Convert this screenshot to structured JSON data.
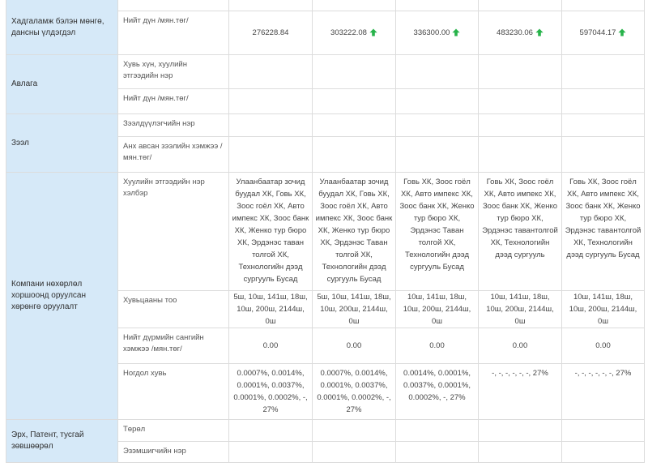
{
  "sections": {
    "assets": {
      "title": "Хадгаламж бэлэн мөнгө, дансны үлдэгдэл",
      "net_label": "Нийт дүн /мян.төг/",
      "values": [
        "276228.84",
        "303222.08",
        "336300.00",
        "483230.06",
        "597044.17"
      ],
      "trend": [
        "none",
        "up",
        "up",
        "up",
        "up"
      ]
    },
    "receivables": {
      "title": "Авлага",
      "person_label": "Хувь хүн, хуулийн этгээдийн нэр",
      "net_label": "Нийт дүн /мян.төг/"
    },
    "loans": {
      "title": "Зээл",
      "lender_label": "Зээлдүүлэгчийн нэр",
      "amount_label": "Анх авсан зээлийн хэмжээ /мян.төг/"
    },
    "investments": {
      "title": "Компани нөхөрлөл хоршоонд оруулсан хөрөнгө оруулалт",
      "entity_label": "Хуулийн этгээдийн нэр хэлбэр",
      "entity_values": [
        "Улаанбаатар зочид буудал ХК, Говь ХК, Зоос гоёл ХК, Авто импекс ХК, Зоос банк ХК, Женко тур бюро ХК, Эрдэнэс таван толгой ХК, Технологийн дээд сургууль Бусад",
        "Улаанбаатар зочид буудал ХК, Говь ХК, Зоос гоёл ХК, Авто импекс ХК, Зоос банк ХК, Женко тур бюро ХК, Эрдэнэс Таван толгой ХК, Технологийн дээд сургууль Бусад",
        "Говь ХК, Зоос гоёл ХК, Авто импекс ХК, Зоос банк ХК, Женко тур бюро ХК, Эрдэнэс Таван толгой ХК, Технологийн дээд сургууль Бусад",
        "Говь ХК, Зоос гоёл ХК, Авто импекс ХК, Зоос банк ХК, Женко тур бюро ХК, Эрдэнэс тавантолгой ХК, Технологийн дээд сургууль",
        "Говь ХК, Зоос гоёл ХК, Авто импекс ХК, Зоос банк ХК, Женко тур бюро ХК, Эрдэнэс тавантолгой ХК, Технологийн дээд сургууль Бусад"
      ],
      "shares_label": "Хувьцааны тоо",
      "shares_values": [
        "5ш, 10ш, 141ш, 18ш, 10ш, 200ш, 2144ш, 0ш",
        "5ш, 10ш, 141ш, 18ш, 10ш, 200ш, 2144ш, 0ш",
        "10ш, 141ш, 18ш, 10ш, 200ш, 2144ш, 0ш",
        "10ш, 141ш, 18ш, 10ш, 200ш, 2144ш, 0ш",
        "10ш, 141ш, 18ш, 10ш, 200ш, 2144ш, 0ш"
      ],
      "capital_label": "Нийт дүрмийн сангийн хэмжээ /мян.төг/",
      "capital_values": [
        "0.00",
        "0.00",
        "0.00",
        "0.00",
        "0.00"
      ],
      "stake_label": "Ногдол хувь",
      "stake_values": [
        "0.0007%, 0.0014%, 0.0001%, 0.0037%, 0.0001%, 0.0002%, -, 27%",
        "0.0007%, 0.0014%, 0.0001%, 0.0037%, 0.0001%, 0.0002%, -, 27%",
        "0.0014%, 0.0001%, 0.0037%, 0.0001%, 0.0002%, -, 27%",
        "-, -, -, -, -, -, 27%",
        "-, -, -, -, -, -, 27%"
      ]
    },
    "rights": {
      "title": "Эрх, Патент, тусгай зөвшөөрөл",
      "type_label": "Төрөл",
      "owner_label": "Эзэмшигчийн нэр"
    }
  },
  "colors": {
    "section_bg": "#d6e9f8",
    "border": "#dcdcdc",
    "trend_up": "#27b34a"
  },
  "icons": {
    "trend_up": "arrow-up-icon"
  }
}
